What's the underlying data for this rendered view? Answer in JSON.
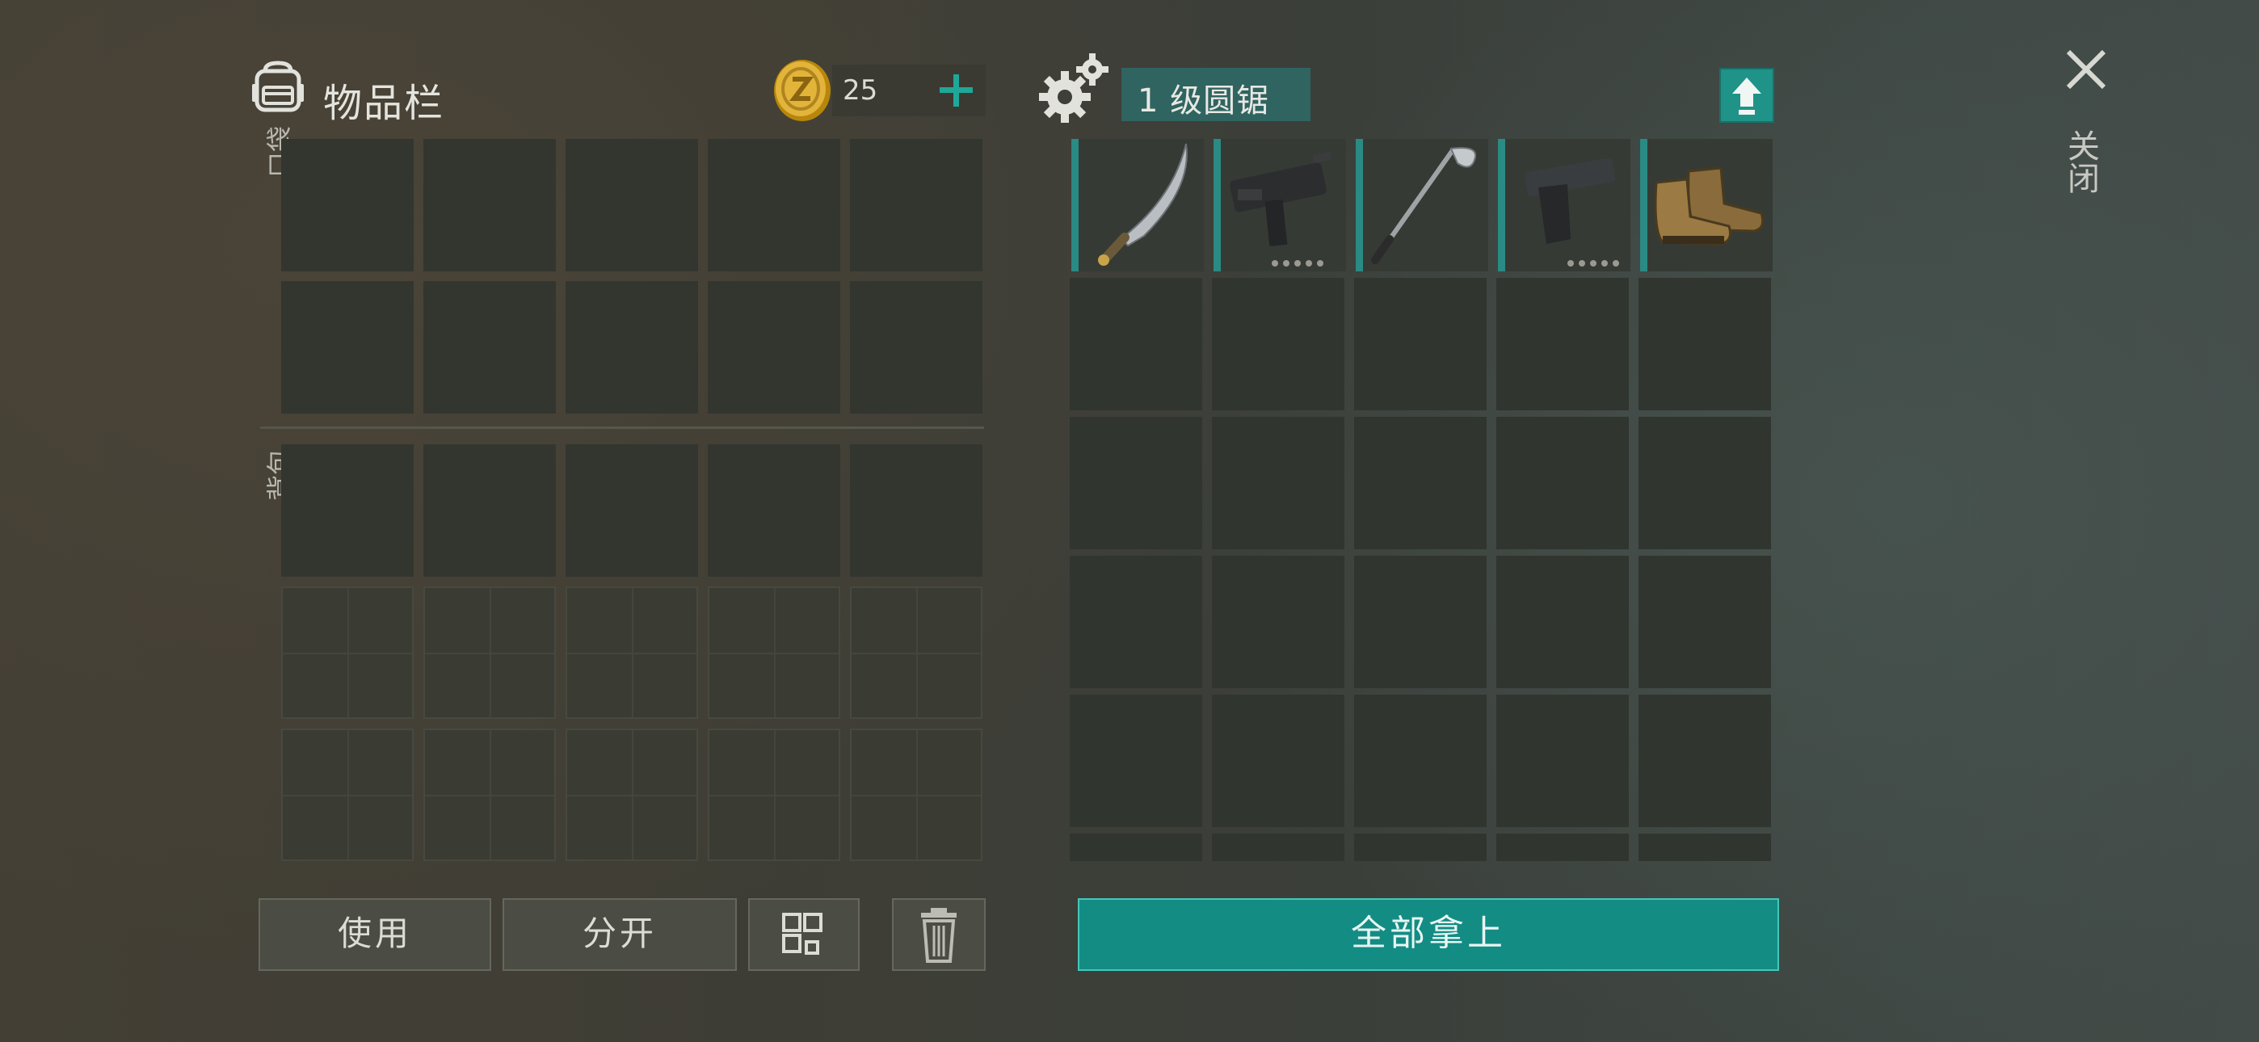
{
  "inventory": {
    "title": "物品栏",
    "coins": "25",
    "pocket_label": "口袋",
    "bag_label": "背包",
    "buttons": {
      "use": "使用",
      "split": "分开"
    }
  },
  "crafting": {
    "title": "1 级圆锯",
    "items": [
      {
        "name": "machete-icon"
      },
      {
        "name": "uzi-icon"
      },
      {
        "name": "golf-club-icon"
      },
      {
        "name": "pistol-icon"
      },
      {
        "name": "boots-icon"
      }
    ],
    "take_all_label": "全部拿上"
  },
  "close_label": "关闭",
  "colors": {
    "accent": "#138c84",
    "slot_bar": "#2a8a84",
    "plus": "#1fa899"
  }
}
